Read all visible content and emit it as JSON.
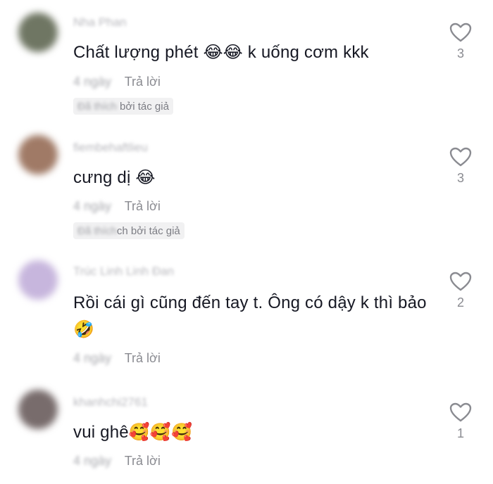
{
  "comments": [
    {
      "username": "Nha Phan",
      "text": "Chất lượng phét 😂😂 k uống cơm kkk",
      "date": "4 ngày",
      "reply": "Trả lời",
      "liked_prefix": "Đã thích",
      "liked_suffix": " bởi tác giả",
      "likes": "3",
      "avatar_color": "#6f7663"
    },
    {
      "username": "fiembehaftlieu",
      "text": "cưng dị 😂",
      "date": "4 ngày",
      "reply": "Trả lời",
      "liked_prefix": "Đã thích",
      "liked_suffix": "ch bởi tác giả",
      "likes": "3",
      "avatar_color": "#a07a66"
    },
    {
      "username": "Trúc Linh Linh Đan",
      "text": "Rồi cái gì cũng đến tay t. Ông có dậy k thì bảo🤣",
      "date": "4 ngày",
      "reply": "Trả lời",
      "likes": "2",
      "avatar_color": "#c7b6dd"
    },
    {
      "username": "khanhchi2761",
      "text": "vui ghê🥰🥰🥰",
      "date": "4 ngày",
      "reply": "Trả lời",
      "likes": "1",
      "avatar_color": "#786c6c"
    }
  ],
  "icons": {
    "like": "heart-outline-icon"
  },
  "colors": {
    "text": "#161823",
    "secondary": "#8a8b91",
    "badge_bg": "#f1f1f2"
  }
}
